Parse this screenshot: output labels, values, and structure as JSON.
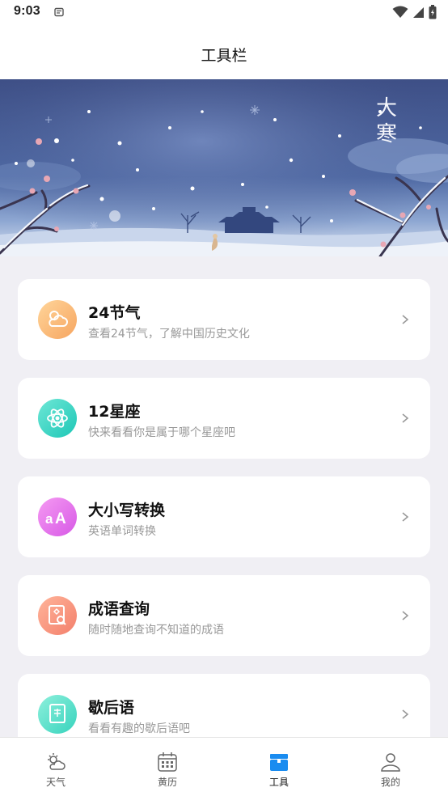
{
  "status_bar": {
    "time": "9:03",
    "icons": [
      "notification-icon",
      "wifi-icon",
      "signal-icon",
      "battery-icon"
    ]
  },
  "header": {
    "title": "工具栏"
  },
  "banner": {
    "calligraphy": "大寒",
    "icon": "snow-winter-illustration"
  },
  "tools": [
    {
      "title": "24节气",
      "desc": "查看24节气，了解中国历史文化",
      "icon": "cloud-sun-icon",
      "color_from": "#ffd59a",
      "color_to": "#f6a560"
    },
    {
      "title": "12星座",
      "desc": "快来看看你是属于哪个星座吧",
      "icon": "atom-icon",
      "color_from": "#6ee7d6",
      "color_to": "#1dc7b6"
    },
    {
      "title": "大小写转换",
      "desc": "英语单词转换",
      "icon": "letter-case-icon",
      "color_from": "#f59af2",
      "color_to": "#d759e6"
    },
    {
      "title": "成语查询",
      "desc": "随时随地查询不知道的成语",
      "icon": "book-search-icon",
      "color_from": "#ffb49a",
      "color_to": "#f37f6b"
    },
    {
      "title": "歇后语",
      "desc": "看看有趣的歇后语吧",
      "icon": "xie-book-icon",
      "color_from": "#8ef0dc",
      "color_to": "#37d3bd"
    }
  ],
  "tabs": [
    {
      "label": "天气",
      "icon": "weather-icon",
      "active": false
    },
    {
      "label": "黄历",
      "icon": "calendar-icon",
      "active": false
    },
    {
      "label": "工具",
      "icon": "toolbox-icon",
      "active": true
    },
    {
      "label": "我的",
      "icon": "profile-icon",
      "active": false
    }
  ],
  "colors": {
    "accent": "#1a8cf0",
    "background": "#f0eff4",
    "card": "#ffffff",
    "muted_text": "#999999"
  }
}
